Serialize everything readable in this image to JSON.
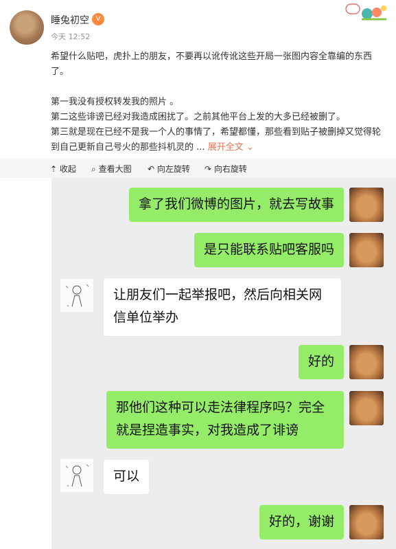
{
  "post": {
    "username": "睡兔初空",
    "time": "今天 12:52",
    "vip_badge": "V",
    "paragraphs": [
      "希望什么贴吧，虎扑上的朋友，不要再以讹传讹这些开局一张图内容全靠编的东西了。",
      "第一我没有授权转发我的照片 。",
      "第二这些诽谤已经对我造成困扰了。之前其他平台上发的大多已经被删了。",
      "第三就是现在已经不是我一个人的事情了，希望都懂，那些看到贴子被删掉又觉得轮到自己更新自己号火的那些抖机灵的"
    ],
    "ellipsis": " ... ",
    "expand_label": "展开全文"
  },
  "toolbar": {
    "collapse_label": "收起",
    "view_image_label": "查看大图",
    "rotate_left_label": "向左旋转",
    "rotate_right_label": "向右旋转"
  },
  "chat": {
    "messages": [
      {
        "side": "right",
        "text": "拿了我们微博的图片，就去写故事"
      },
      {
        "side": "right",
        "text": "是只能联系贴吧客服吗"
      },
      {
        "side": "left",
        "text": "让朋友们一起举报吧，然后向相关网信单位举办"
      },
      {
        "side": "right",
        "text": "好的"
      },
      {
        "side": "right",
        "text": "那他们这种可以走法律程序吗？完全就是捏造事实，对我造成了诽谤"
      },
      {
        "side": "left",
        "text": "可以"
      },
      {
        "side": "right",
        "text": "好的，谢谢"
      }
    ]
  },
  "colors": {
    "green_bubble": "#95ec69",
    "chat_bg": "#ededed",
    "expand_link": "#eb7350"
  }
}
